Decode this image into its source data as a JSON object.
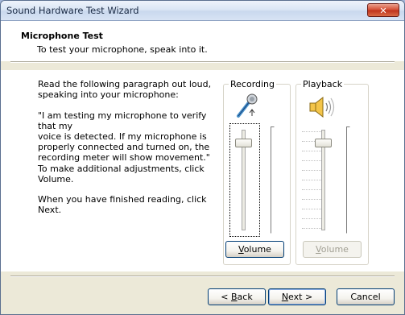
{
  "window": {
    "title": "Sound Hardware Test Wizard",
    "close_glyph": "✕"
  },
  "header": {
    "title": "Microphone Test",
    "subtitle": "To test your microphone, speak into it."
  },
  "instructions": {
    "p1_line1": "Read the following paragraph out loud,",
    "p1_line2": "speaking into your microphone:",
    "quote_line1": "\"I am testing my microphone to verify that my",
    "quote_line2": "voice is detected. If my microphone is",
    "quote_line3": "properly connected and turned on, the",
    "quote_line4": "recording meter will show movement.\"",
    "p3_line1": "To make additional adjustments, click",
    "p3_line2": "Volume.",
    "p4": "When you have finished reading, click Next."
  },
  "recording": {
    "label": "Recording",
    "icon": "microphone-icon",
    "volume_level": 0.9,
    "meter_level": 0,
    "button_pre": "",
    "button_accel": "V",
    "button_post": "olume"
  },
  "playback": {
    "label": "Playback",
    "icon": "speaker-icon",
    "volume_level": 0.9,
    "meter_level": 0,
    "button_pre": "",
    "button_accel": "V",
    "button_post": "olume",
    "enabled": false
  },
  "footer": {
    "back_pre": "< ",
    "back_accel": "B",
    "back_post": "ack",
    "next_pre": "",
    "next_accel": "N",
    "next_post": "ext >",
    "cancel": "Cancel"
  },
  "colors": {
    "accent": "#003c74",
    "title_bar": "#dbe6f5",
    "close": "#c0341c"
  }
}
